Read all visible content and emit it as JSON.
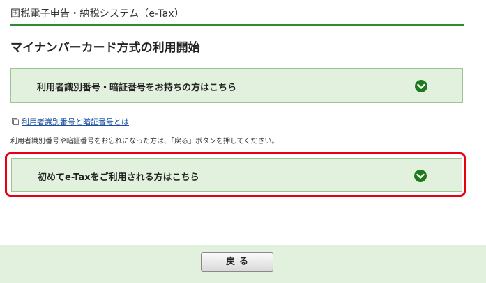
{
  "header": {
    "app_title": "国税電子申告・納税システム（e-Tax）"
  },
  "page": {
    "title": "マイナンバーカード方式の利用開始"
  },
  "accordions": [
    {
      "label": "利用者識別番号・暗証番号をお持ちの方はこちら",
      "icon": "chevron-down-circle-icon"
    },
    {
      "label": "初めてe-Taxをご利用される方はこちら",
      "icon": "chevron-down-circle-icon"
    }
  ],
  "help_link": {
    "label": "利用者識別番号と暗証番号とは",
    "icon": "document-icon"
  },
  "note": "利用者識別番号や暗証番号をお忘れになった方は、「戻る」ボタンを押してください。",
  "footer": {
    "back_label": "戻る"
  },
  "colors": {
    "accent_green": "#2e8b2e",
    "panel_bg": "#e2f1de",
    "highlight_red": "#e60012",
    "link_blue": "#1a4fa0"
  }
}
